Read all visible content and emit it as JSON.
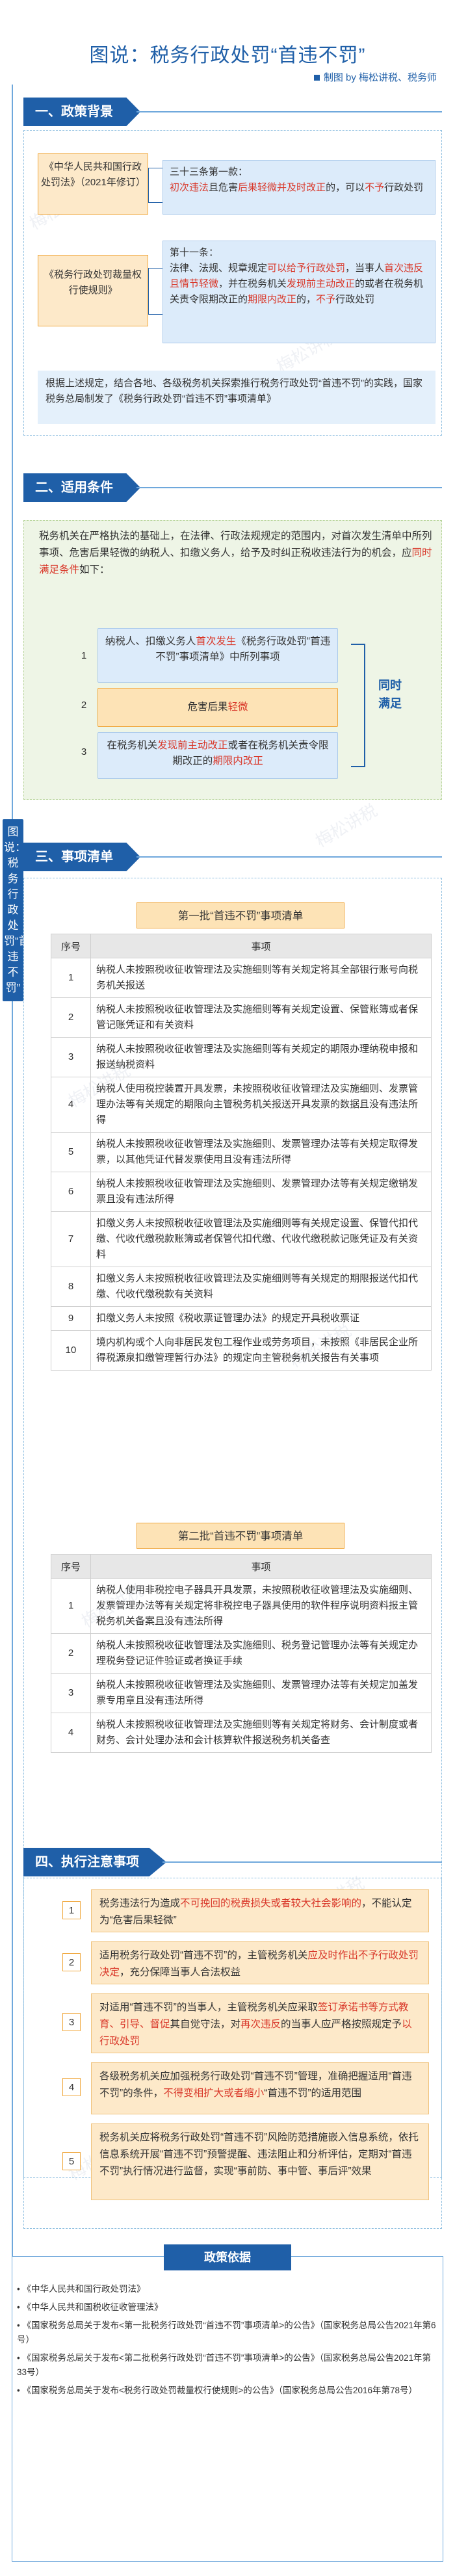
{
  "header": {
    "title": "图说：税务行政处罚“首违不罚”",
    "byline": "制图 by 梅松讲税、税务师"
  },
  "watermark": "梅松讲税",
  "spine_label": "图说：税务行政处罚“首违不罚”",
  "sections": {
    "s1": "一、政策背景",
    "s2": "二、适用条件",
    "s3": "三、事项清单",
    "s4": "四、执行注意事项"
  },
  "background": {
    "law1_name": "《中华人民共和国行政处罚法》（2021年修订）",
    "law2_name": "《税务行政处罚裁量权行使规则》",
    "law1_clause_title": "三十三条第一款：",
    "law1_clause_a": "初次违法",
    "law1_clause_b": "且危害",
    "law1_clause_c": "后果轻微",
    "law1_clause_d": "并及时改正",
    "law1_clause_e": "的，可以",
    "law1_clause_f": "不予",
    "law1_clause_g": "行政处罚",
    "law2_clause_title": "第十一条：",
    "law2_clause_a": "法律、法规、规章规定",
    "law2_clause_b": "可以给予行政处罚",
    "law2_clause_c": "，当事人",
    "law2_clause_d": "首次违反且情节轻微",
    "law2_clause_e": "，并在税务机关",
    "law2_clause_f": "发现前主动改正",
    "law2_clause_g": "的或者在税务机关责令限期改正的",
    "law2_clause_h": "期限内改正",
    "law2_clause_i": "的，",
    "law2_clause_j": "不予",
    "law2_clause_k": "行政处罚",
    "note": "根据上述规定，结合各地、各级税务机关探索推行税务行政处罚“首违不罚”的实践，国家税务总局制发了《税务行政处罚“首违不罚”事项清单》"
  },
  "conditions": {
    "intro_a": "税务机关在严格执法的基础上，在法律、行政法规规定的范围内，对首次发生清单中所列事项、危害后果轻微的纳税人、扣缴义务人，给予及时纠正税收违法行为的机会，应",
    "intro_b": "同时满足条件",
    "intro_c": "如下：",
    "items": [
      {
        "num": "1",
        "a": "纳税人、扣缴义务人",
        "b": "首次发生",
        "c": "《税务行政处罚“首违不罚”事项清单》中所列事项"
      },
      {
        "num": "2",
        "a": "危害后果",
        "b": "轻微",
        "c": ""
      },
      {
        "num": "3",
        "a": "在税务机关",
        "b": "发现前主动改正",
        "c": "或者在税务机关责令限期改正的",
        "d": "期限内改正"
      }
    ],
    "label": "同时满足"
  },
  "list1": {
    "title": "第一批“首违不罚”事项清单",
    "col_num": "序号",
    "col_item": "事项",
    "rows": [
      {
        "n": "1",
        "text": "纳税人未按照税收征收管理法及实施细则等有关规定将其全部银行账号向税务机关报送"
      },
      {
        "n": "2",
        "text": "纳税人未按照税收征收管理法及实施细则等有关规定设置、保管账簿或者保管记账凭证和有关资料"
      },
      {
        "n": "3",
        "text": "纳税人未按照税收征收管理法及实施细则等有关规定的期限办理纳税申报和报送纳税资料"
      },
      {
        "n": "4",
        "text": "纳税人使用税控装置开具发票，未按照税收征收管理法及实施细则、发票管理办法等有关规定的期限向主管税务机关报送开具发票的数据且没有违法所得"
      },
      {
        "n": "5",
        "text": "纳税人未按照税收征收管理法及实施细则、发票管理办法等有关规定取得发票，以其他凭证代替发票使用且没有违法所得"
      },
      {
        "n": "6",
        "text": "纳税人未按照税收征收管理法及实施细则、发票管理办法等有关规定缴销发票且没有违法所得"
      },
      {
        "n": "7",
        "text": "扣缴义务人未按照税收征收管理法及实施细则等有关规定设置、保管代扣代缴、代收代缴税款账簿或者保管代扣代缴、代收代缴税款记账凭证及有关资料"
      },
      {
        "n": "8",
        "text": "扣缴义务人未按照税收征收管理法及实施细则等有关规定的期限报送代扣代缴、代收代缴税款有关资料"
      },
      {
        "n": "9",
        "text": "扣缴义务人未按照《税收票证管理办法》的规定开具税收票证"
      },
      {
        "n": "10",
        "text": "境内机构或个人向非居民发包工程作业或劳务项目，未按照《非居民企业所得税源泉扣缴管理暂行办法》的规定向主管税务机关报告有关事项"
      }
    ]
  },
  "list2": {
    "title": "第二批“首违不罚”事项清单",
    "col_num": "序号",
    "col_item": "事项",
    "rows": [
      {
        "n": "1",
        "text": "纳税人使用非税控电子器具开具发票，未按照税收征收管理法及实施细则、发票管理办法等有关规定将非税控电子器具使用的软件程序说明资料报主管税务机关备案且没有违法所得"
      },
      {
        "n": "2",
        "text": "纳税人未按照税收征收管理法及实施细则、税务登记管理办法等有关规定办理税务登记证件验证或者换证手续"
      },
      {
        "n": "3",
        "text": "纳税人未按照税收征收管理法及实施细则、发票管理办法等有关规定加盖发票专用章且没有违法所得"
      },
      {
        "n": "4",
        "text": "纳税人未按照税收征收管理法及实施细则等有关规定将财务、会计制度或者财务、会计处理办法和会计核算软件报送税务机关备查"
      }
    ]
  },
  "notes": [
    {
      "n": "1",
      "a": "税务违法行为造成",
      "b": "不可挽回的税费损失或者较大社会影响的",
      "c": "，不能认定为“危害后果轻微”"
    },
    {
      "n": "2",
      "a": "适用税务行政处罚“首违不罚”的，主管税务机关",
      "b": "应及时作出不予行政处罚决定",
      "c": "，充分保障当事人合法权益"
    },
    {
      "n": "3",
      "a": "对适用“首违不罚”的当事人，主管税务机关应采取",
      "b": "签订承诺书等方式教育、引导、督促",
      "c": "其自觉守法，对",
      "d": "再次违反",
      "e": "的当事人应严格按照规定予",
      "f": "以行政处罚"
    },
    {
      "n": "4",
      "a": "各级税务机关应加强税务行政处罚“首违不罚”管理，准确把握适用“首违不罚”的条件，",
      "b": "不得变相扩大或者缩小",
      "c": "“首违不罚”的适用范围"
    },
    {
      "n": "5",
      "a": "税务机关应将税务行政处罚“首违不罚”风险防范措施嵌入信息系统，依托信息系统开展“首违不罚”预警提醒、违法阻止和分析评估，定期对“首违不罚”执行情况进行监督，实现“事前防、事中管、事后评”效果"
    }
  ],
  "basis": {
    "head": "政策依据",
    "items": [
      "《中华人民共和国行政处罚法》",
      "《中华人民共和国税收征收管理法》",
      "《国家税务总局关于发布<第一批税务行政处罚“首违不罚”事项清单>的公告》（国家税务总局公告2021年第6号）",
      "《国家税务总局关于发布<第二批税务行政处罚“首违不罚”事项清单>的公告》（国家税务总局公告2021年第33号）",
      "《国家税务总局关于发布<税务行政处罚裁量权行使规则>的公告》（国家税务总局公告2016年第78号）"
    ]
  }
}
